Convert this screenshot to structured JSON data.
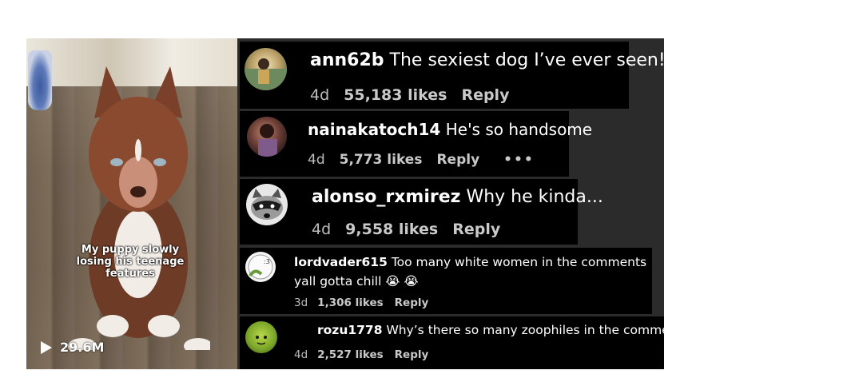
{
  "video": {
    "caption": "My puppy slowly losing his teenage features",
    "views": "29.6M"
  },
  "comments": [
    {
      "username": "ann62b",
      "text": "The sexiest dog I’ve ever seen!",
      "age": "4d",
      "likes": "55,183 likes",
      "reply": "Reply"
    },
    {
      "username": "nainakatoch14",
      "text": "He's so handsome",
      "age": "4d",
      "likes": "5,773 likes",
      "reply": "Reply",
      "more": "•••"
    },
    {
      "username": "alonso_rxmirez",
      "text": "Why he kinda...",
      "age": "4d",
      "likes": "9,558 likes",
      "reply": "Reply"
    },
    {
      "username": "lordvader615",
      "text": "Too many white women in the comments yall gotta chill 😭 😭",
      "age": "3d",
      "likes": "1,306 likes",
      "reply": "Reply"
    },
    {
      "username": "rozu1778",
      "text": "Why’s there so many zoophiles in the comments",
      "age": "4d",
      "likes": "2,527 likes",
      "reply": "Reply"
    }
  ]
}
